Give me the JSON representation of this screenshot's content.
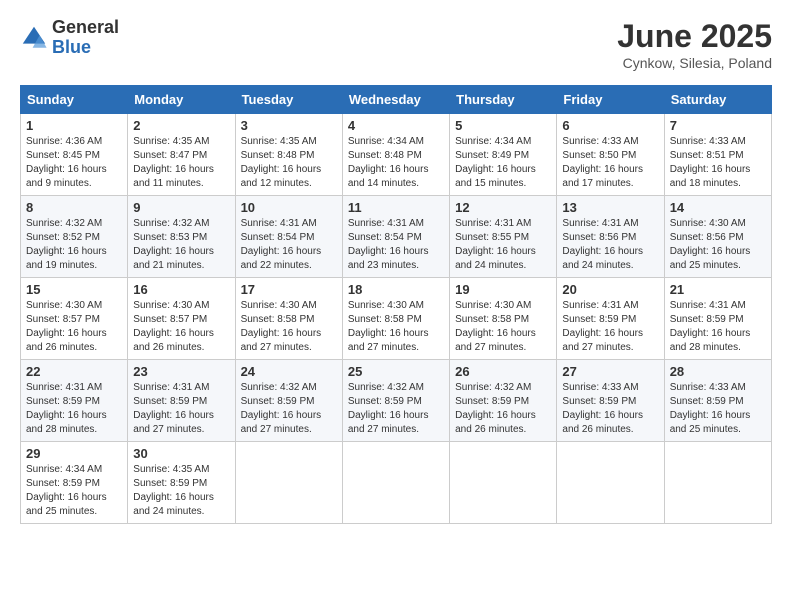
{
  "logo": {
    "general": "General",
    "blue": "Blue"
  },
  "title": "June 2025",
  "location": "Cynkow, Silesia, Poland",
  "days_of_week": [
    "Sunday",
    "Monday",
    "Tuesday",
    "Wednesday",
    "Thursday",
    "Friday",
    "Saturday"
  ],
  "weeks": [
    [
      {
        "day": "1",
        "sunrise": "4:36 AM",
        "sunset": "8:45 PM",
        "daylight": "16 hours and 9 minutes."
      },
      {
        "day": "2",
        "sunrise": "4:35 AM",
        "sunset": "8:47 PM",
        "daylight": "16 hours and 11 minutes."
      },
      {
        "day": "3",
        "sunrise": "4:35 AM",
        "sunset": "8:48 PM",
        "daylight": "16 hours and 12 minutes."
      },
      {
        "day": "4",
        "sunrise": "4:34 AM",
        "sunset": "8:48 PM",
        "daylight": "16 hours and 14 minutes."
      },
      {
        "day": "5",
        "sunrise": "4:34 AM",
        "sunset": "8:49 PM",
        "daylight": "16 hours and 15 minutes."
      },
      {
        "day": "6",
        "sunrise": "4:33 AM",
        "sunset": "8:50 PM",
        "daylight": "16 hours and 17 minutes."
      },
      {
        "day": "7",
        "sunrise": "4:33 AM",
        "sunset": "8:51 PM",
        "daylight": "16 hours and 18 minutes."
      }
    ],
    [
      {
        "day": "8",
        "sunrise": "4:32 AM",
        "sunset": "8:52 PM",
        "daylight": "16 hours and 19 minutes."
      },
      {
        "day": "9",
        "sunrise": "4:32 AM",
        "sunset": "8:53 PM",
        "daylight": "16 hours and 21 minutes."
      },
      {
        "day": "10",
        "sunrise": "4:31 AM",
        "sunset": "8:54 PM",
        "daylight": "16 hours and 22 minutes."
      },
      {
        "day": "11",
        "sunrise": "4:31 AM",
        "sunset": "8:54 PM",
        "daylight": "16 hours and 23 minutes."
      },
      {
        "day": "12",
        "sunrise": "4:31 AM",
        "sunset": "8:55 PM",
        "daylight": "16 hours and 24 minutes."
      },
      {
        "day": "13",
        "sunrise": "4:31 AM",
        "sunset": "8:56 PM",
        "daylight": "16 hours and 24 minutes."
      },
      {
        "day": "14",
        "sunrise": "4:30 AM",
        "sunset": "8:56 PM",
        "daylight": "16 hours and 25 minutes."
      }
    ],
    [
      {
        "day": "15",
        "sunrise": "4:30 AM",
        "sunset": "8:57 PM",
        "daylight": "16 hours and 26 minutes."
      },
      {
        "day": "16",
        "sunrise": "4:30 AM",
        "sunset": "8:57 PM",
        "daylight": "16 hours and 26 minutes."
      },
      {
        "day": "17",
        "sunrise": "4:30 AM",
        "sunset": "8:58 PM",
        "daylight": "16 hours and 27 minutes."
      },
      {
        "day": "18",
        "sunrise": "4:30 AM",
        "sunset": "8:58 PM",
        "daylight": "16 hours and 27 minutes."
      },
      {
        "day": "19",
        "sunrise": "4:30 AM",
        "sunset": "8:58 PM",
        "daylight": "16 hours and 27 minutes."
      },
      {
        "day": "20",
        "sunrise": "4:31 AM",
        "sunset": "8:59 PM",
        "daylight": "16 hours and 27 minutes."
      },
      {
        "day": "21",
        "sunrise": "4:31 AM",
        "sunset": "8:59 PM",
        "daylight": "16 hours and 28 minutes."
      }
    ],
    [
      {
        "day": "22",
        "sunrise": "4:31 AM",
        "sunset": "8:59 PM",
        "daylight": "16 hours and 28 minutes."
      },
      {
        "day": "23",
        "sunrise": "4:31 AM",
        "sunset": "8:59 PM",
        "daylight": "16 hours and 27 minutes."
      },
      {
        "day": "24",
        "sunrise": "4:32 AM",
        "sunset": "8:59 PM",
        "daylight": "16 hours and 27 minutes."
      },
      {
        "day": "25",
        "sunrise": "4:32 AM",
        "sunset": "8:59 PM",
        "daylight": "16 hours and 27 minutes."
      },
      {
        "day": "26",
        "sunrise": "4:32 AM",
        "sunset": "8:59 PM",
        "daylight": "16 hours and 26 minutes."
      },
      {
        "day": "27",
        "sunrise": "4:33 AM",
        "sunset": "8:59 PM",
        "daylight": "16 hours and 26 minutes."
      },
      {
        "day": "28",
        "sunrise": "4:33 AM",
        "sunset": "8:59 PM",
        "daylight": "16 hours and 25 minutes."
      }
    ],
    [
      {
        "day": "29",
        "sunrise": "4:34 AM",
        "sunset": "8:59 PM",
        "daylight": "16 hours and 25 minutes."
      },
      {
        "day": "30",
        "sunrise": "4:35 AM",
        "sunset": "8:59 PM",
        "daylight": "16 hours and 24 minutes."
      },
      null,
      null,
      null,
      null,
      null
    ]
  ]
}
